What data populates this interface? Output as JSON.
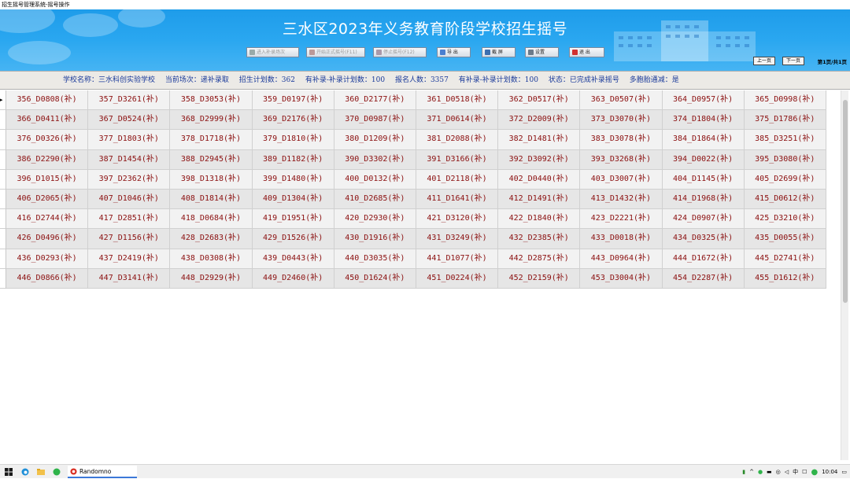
{
  "window": {
    "title": "招生摇号管理系统-摇号操作"
  },
  "banner": {
    "title": "三水区2023年义务教育阶段学校招生摇号",
    "toolbar": [
      {
        "label": "进入补录场次",
        "icon": "enter-icon",
        "enabled": false
      },
      {
        "label": "开始正式摇号(F11)",
        "icon": "people-icon",
        "enabled": false
      },
      {
        "label": "停止摇号(F12)",
        "icon": "stop-person-icon",
        "enabled": false
      },
      {
        "label": "导 出",
        "icon": "export-icon",
        "enabled": true
      },
      {
        "label": "截 屏",
        "icon": "screen-icon",
        "enabled": true
      },
      {
        "label": "设置",
        "icon": "settings-icon",
        "enabled": true
      },
      {
        "label": "退 出",
        "icon": "exit-icon",
        "enabled": true
      }
    ],
    "prev_page": "上一页",
    "next_page": "下一页",
    "page_info": "第1页/共1页"
  },
  "info": {
    "school": "学校名称：三水科创实验学校",
    "session": "当前场次：递补录取",
    "plan": "招生计划数：362",
    "supplement": "有补录-补录计划数：100",
    "applicants": "报名人数：3357",
    "supplement2": "有补录-补录计划数：100",
    "status": "状态：已完成补录摇号",
    "twins": "多胞胎通减：是"
  },
  "grid": {
    "marker": "▸",
    "rows": [
      [
        "356_D0808(补)",
        "357_D3261(补)",
        "358_D3053(补)",
        "359_D0197(补)",
        "360_D2177(补)",
        "361_D0518(补)",
        "362_D0517(补)",
        "363_D0507(补)",
        "364_D0957(补)",
        "365_D0998(补)"
      ],
      [
        "366_D0411(补)",
        "367_D0524(补)",
        "368_D2999(补)",
        "369_D2176(补)",
        "370_D0987(补)",
        "371_D0614(补)",
        "372_D2009(补)",
        "373_D3070(补)",
        "374_D1804(补)",
        "375_D1786(补)"
      ],
      [
        "376_D0326(补)",
        "377_D1803(补)",
        "378_D1718(补)",
        "379_D1810(补)",
        "380_D1209(补)",
        "381_D2088(补)",
        "382_D1481(补)",
        "383_D3078(补)",
        "384_D1864(补)",
        "385_D3251(补)"
      ],
      [
        "386_D2290(补)",
        "387_D1454(补)",
        "388_D2945(补)",
        "389_D1182(补)",
        "390_D3302(补)",
        "391_D3166(补)",
        "392_D3092(补)",
        "393_D3268(补)",
        "394_D0022(补)",
        "395_D3080(补)"
      ],
      [
        "396_D1015(补)",
        "397_D2362(补)",
        "398_D1318(补)",
        "399_D1480(补)",
        "400_D0132(补)",
        "401_D2118(补)",
        "402_D0440(补)",
        "403_D3007(补)",
        "404_D1145(补)",
        "405_D2699(补)"
      ],
      [
        "406_D2065(补)",
        "407_D1046(补)",
        "408_D1814(补)",
        "409_D1304(补)",
        "410_D2685(补)",
        "411_D1641(补)",
        "412_D1491(补)",
        "413_D1432(补)",
        "414_D1968(补)",
        "415_D0612(补)"
      ],
      [
        "416_D2744(补)",
        "417_D2851(补)",
        "418_D0684(补)",
        "419_D1951(补)",
        "420_D2930(补)",
        "421_D3120(补)",
        "422_D1840(补)",
        "423_D2221(补)",
        "424_D0907(补)",
        "425_D3210(补)"
      ],
      [
        "426_D0496(补)",
        "427_D1156(补)",
        "428_D2683(补)",
        "429_D1526(补)",
        "430_D1916(补)",
        "431_D3249(补)",
        "432_D2385(补)",
        "433_D0018(补)",
        "434_D0325(补)",
        "435_D0055(补)"
      ],
      [
        "436_D0293(补)",
        "437_D2419(补)",
        "438_D0308(补)",
        "439_D0443(补)",
        "440_D3035(补)",
        "441_D1077(补)",
        "442_D2875(补)",
        "443_D0964(补)",
        "444_D1672(补)",
        "445_D2741(补)"
      ],
      [
        "446_D0866(补)",
        "447_D3141(补)",
        "448_D2929(补)",
        "449_D2460(补)",
        "450_D1624(补)",
        "451_D0224(补)",
        "452_D2159(补)",
        "453_D3004(补)",
        "454_D2287(补)",
        "455_D1612(补)"
      ]
    ]
  },
  "taskbar": {
    "app_label": "Randomno",
    "ime": "中",
    "time": "10:04"
  }
}
